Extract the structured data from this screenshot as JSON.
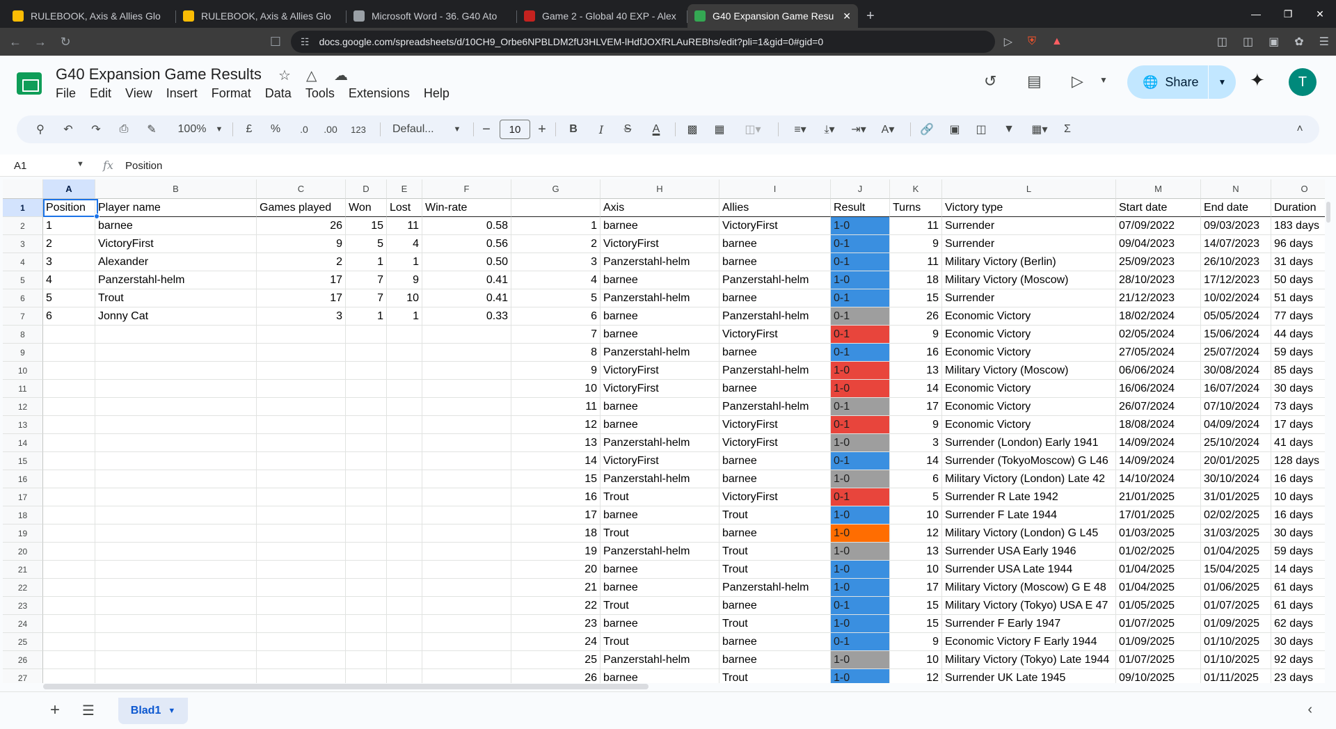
{
  "browser": {
    "tabs": [
      {
        "title": "RULEBOOK, Axis & Allies Glo",
        "icon": "google-drive-icon",
        "color": "#fbbc04"
      },
      {
        "title": "RULEBOOK, Axis & Allies Glo",
        "icon": "google-drive-icon",
        "color": "#fbbc04"
      },
      {
        "title": "Microsoft Word - 36. G40 Ato",
        "icon": "globe-icon",
        "color": "#9aa0a6"
      },
      {
        "title": "Game 2 - Global 40 EXP - Alex",
        "icon": "site-icon",
        "color": "#c5221f"
      },
      {
        "title": "G40 Expansion Game Resu",
        "icon": "sheets-icon",
        "color": "#34a853",
        "active": true
      }
    ],
    "url": "docs.google.com/spreadsheets/d/10CH9_Orbe6NPBLDM2fU3HLVEM-lHdfJOXfRLAuREBhs/edit?pli=1&gid=0#gid=0"
  },
  "doc": {
    "title": "G40 Expansion Game Results",
    "menus": [
      "File",
      "Edit",
      "View",
      "Insert",
      "Format",
      "Data",
      "Tools",
      "Extensions",
      "Help"
    ],
    "share_label": "Share",
    "avatar_letter": "T"
  },
  "toolbar": {
    "zoom": "100%",
    "currency": "£",
    "percent": "%",
    "dec_decrease": ".0",
    "dec_increase": ".00",
    "number_format": "123",
    "font": "Defaul...",
    "font_size": "10",
    "bold": "B",
    "italic": "I",
    "text_color": "A"
  },
  "formula_bar": {
    "cell_ref": "A1",
    "fx": "fx",
    "value": "Position"
  },
  "columns": [
    "A",
    "B",
    "C",
    "D",
    "E",
    "F",
    "G",
    "H",
    "I",
    "J",
    "K",
    "L",
    "M",
    "N",
    "O"
  ],
  "rows": [
    [
      "Position",
      "Player name",
      "Games played",
      "Won",
      "Lost",
      "Win-rate",
      "",
      "Axis",
      "Allies",
      "Result",
      "Turns",
      "Victory type",
      "Start date",
      "End date",
      "Duration"
    ],
    [
      "1",
      "barnee",
      "26",
      "15",
      "11",
      "0.58",
      "1",
      "barnee",
      "VictoryFirst",
      "1-0",
      "11",
      "Surrender",
      "07/09/2022",
      "09/03/2023",
      "183 days"
    ],
    [
      "2",
      "VictoryFirst",
      "9",
      "5",
      "4",
      "0.56",
      "2",
      "VictoryFirst",
      "barnee",
      "0-1",
      "9",
      "Surrender",
      "09/04/2023",
      "14/07/2023",
      "96 days"
    ],
    [
      "3",
      "Alexander",
      "2",
      "1",
      "1",
      "0.50",
      "3",
      "Panzerstahl-helm",
      "barnee",
      "0-1",
      "11",
      "Military Victory (Berlin)",
      "25/09/2023",
      "26/10/2023",
      "31 days"
    ],
    [
      "4",
      "Panzerstahl-helm",
      "17",
      "7",
      "9",
      "0.41",
      "4",
      "barnee",
      "Panzerstahl-helm",
      "1-0",
      "18",
      "Military Victory (Moscow)",
      "28/10/2023",
      "17/12/2023",
      "50 days"
    ],
    [
      "5",
      "Trout",
      "17",
      "7",
      "10",
      "0.41",
      "5",
      "Panzerstahl-helm",
      "barnee",
      "0-1",
      "15",
      "Surrender",
      "21/12/2023",
      "10/02/2024",
      "51 days"
    ],
    [
      "6",
      "Jonny Cat",
      "3",
      "1",
      "1",
      "0.33",
      "6",
      "barnee",
      "Panzerstahl-helm",
      "0-1",
      "26",
      "Economic Victory",
      "18/02/2024",
      "05/05/2024",
      "77 days"
    ],
    [
      "",
      "",
      "",
      "",
      "",
      "",
      "7",
      "barnee",
      "VictoryFirst",
      "0-1",
      "9",
      "Economic Victory",
      "02/05/2024",
      "15/06/2024",
      "44 days"
    ],
    [
      "",
      "",
      "",
      "",
      "",
      "",
      "8",
      "Panzerstahl-helm",
      "barnee",
      "0-1",
      "16",
      "Economic Victory",
      "27/05/2024",
      "25/07/2024",
      "59 days"
    ],
    [
      "",
      "",
      "",
      "",
      "",
      "",
      "9",
      "VictoryFirst",
      "Panzerstahl-helm",
      "1-0",
      "13",
      "Military Victory (Moscow)",
      "06/06/2024",
      "30/08/2024",
      "85 days"
    ],
    [
      "",
      "",
      "",
      "",
      "",
      "",
      "10",
      "VictoryFirst",
      "barnee",
      "1-0",
      "14",
      "Economic Victory",
      "16/06/2024",
      "16/07/2024",
      "30 days"
    ],
    [
      "",
      "",
      "",
      "",
      "",
      "",
      "11",
      "barnee",
      "Panzerstahl-helm",
      "0-1",
      "17",
      "Economic Victory",
      "26/07/2024",
      "07/10/2024",
      "73 days"
    ],
    [
      "",
      "",
      "",
      "",
      "",
      "",
      "12",
      "barnee",
      "VictoryFirst",
      "0-1",
      "9",
      "Economic Victory",
      "18/08/2024",
      "04/09/2024",
      "17 days"
    ],
    [
      "",
      "",
      "",
      "",
      "",
      "",
      "13",
      "Panzerstahl-helm",
      "VictoryFirst",
      "1-0",
      "3",
      "Surrender (London) Early 1941",
      "14/09/2024",
      "25/10/2024",
      "41 days"
    ],
    [
      "",
      "",
      "",
      "",
      "",
      "",
      "14",
      "VictoryFirst",
      "barnee",
      "0-1",
      "14",
      "Surrender (TokyoMoscow) G L46",
      "14/09/2024",
      "20/01/2025",
      "128 days"
    ],
    [
      "",
      "",
      "",
      "",
      "",
      "",
      "15",
      "Panzerstahl-helm",
      "barnee",
      "1-0",
      "6",
      "Military Victory (London) Late 42",
      "14/10/2024",
      "30/10/2024",
      "16 days"
    ],
    [
      "",
      "",
      "",
      "",
      "",
      "",
      "16",
      "Trout",
      "VictoryFirst",
      "0-1",
      "5",
      "Surrender R Late 1942",
      "21/01/2025",
      "31/01/2025",
      "10 days"
    ],
    [
      "",
      "",
      "",
      "",
      "",
      "",
      "17",
      "barnee",
      "Trout",
      "1-0",
      "10",
      "Surrender F Late 1944",
      "17/01/2025",
      "02/02/2025",
      "16 days"
    ],
    [
      "",
      "",
      "",
      "",
      "",
      "",
      "18",
      "Trout",
      "barnee",
      "1-0",
      "12",
      "Military Victory (London) G L45",
      "01/03/2025",
      "31/03/2025",
      "30 days"
    ],
    [
      "",
      "",
      "",
      "",
      "",
      "",
      "19",
      "Panzerstahl-helm",
      "Trout",
      "1-0",
      "13",
      "Surrender USA Early 1946",
      "01/02/2025",
      "01/04/2025",
      "59 days"
    ],
    [
      "",
      "",
      "",
      "",
      "",
      "",
      "20",
      "barnee",
      "Trout",
      "1-0",
      "10",
      "Surrender USA Late 1944",
      "01/04/2025",
      "15/04/2025",
      "14 days"
    ],
    [
      "",
      "",
      "",
      "",
      "",
      "",
      "21",
      "barnee",
      "Panzerstahl-helm",
      "1-0",
      "17",
      "Military Victory (Moscow) G E 48",
      "01/04/2025",
      "01/06/2025",
      "61 days"
    ],
    [
      "",
      "",
      "",
      "",
      "",
      "",
      "22",
      "Trout",
      "barnee",
      "0-1",
      "15",
      "Military Victory (Tokyo) USA E 47",
      "01/05/2025",
      "01/07/2025",
      "61 days"
    ],
    [
      "",
      "",
      "",
      "",
      "",
      "",
      "23",
      "barnee",
      "Trout",
      "1-0",
      "15",
      "Surrender F Early 1947",
      "01/07/2025",
      "01/09/2025",
      "62 days"
    ],
    [
      "",
      "",
      "",
      "",
      "",
      "",
      "24",
      "Trout",
      "barnee",
      "0-1",
      "9",
      "Economic Victory F Early 1944",
      "01/09/2025",
      "01/10/2025",
      "30 days"
    ],
    [
      "",
      "",
      "",
      "",
      "",
      "",
      "25",
      "Panzerstahl-helm",
      "barnee",
      "1-0",
      "10",
      "Military Victory (Tokyo) Late 1944",
      "01/07/2025",
      "01/10/2025",
      "92 days"
    ],
    [
      "",
      "",
      "",
      "",
      "",
      "",
      "26",
      "barnee",
      "Trout",
      "1-0",
      "12",
      "Surrender UK Late 1945",
      "09/10/2025",
      "01/11/2025",
      "23 days"
    ]
  ],
  "result_colors": [
    "",
    "#3a8fe0",
    "#3a8fe0",
    "#3a8fe0",
    "#3a8fe0",
    "#3a8fe0",
    "#9e9e9e",
    "#e8453c",
    "#3a8fe0",
    "#e8453c",
    "#e8453c",
    "#9e9e9e",
    "#e8453c",
    "#9e9e9e",
    "#3a8fe0",
    "#9e9e9e",
    "#e8453c",
    "#3a8fe0",
    "#ff6d01",
    "#9e9e9e",
    "#3a8fe0",
    "#3a8fe0",
    "#3a8fe0",
    "#3a8fe0",
    "#3a8fe0",
    "#9e9e9e",
    "#3a8fe0"
  ],
  "sheets": {
    "active": "Blad1"
  }
}
